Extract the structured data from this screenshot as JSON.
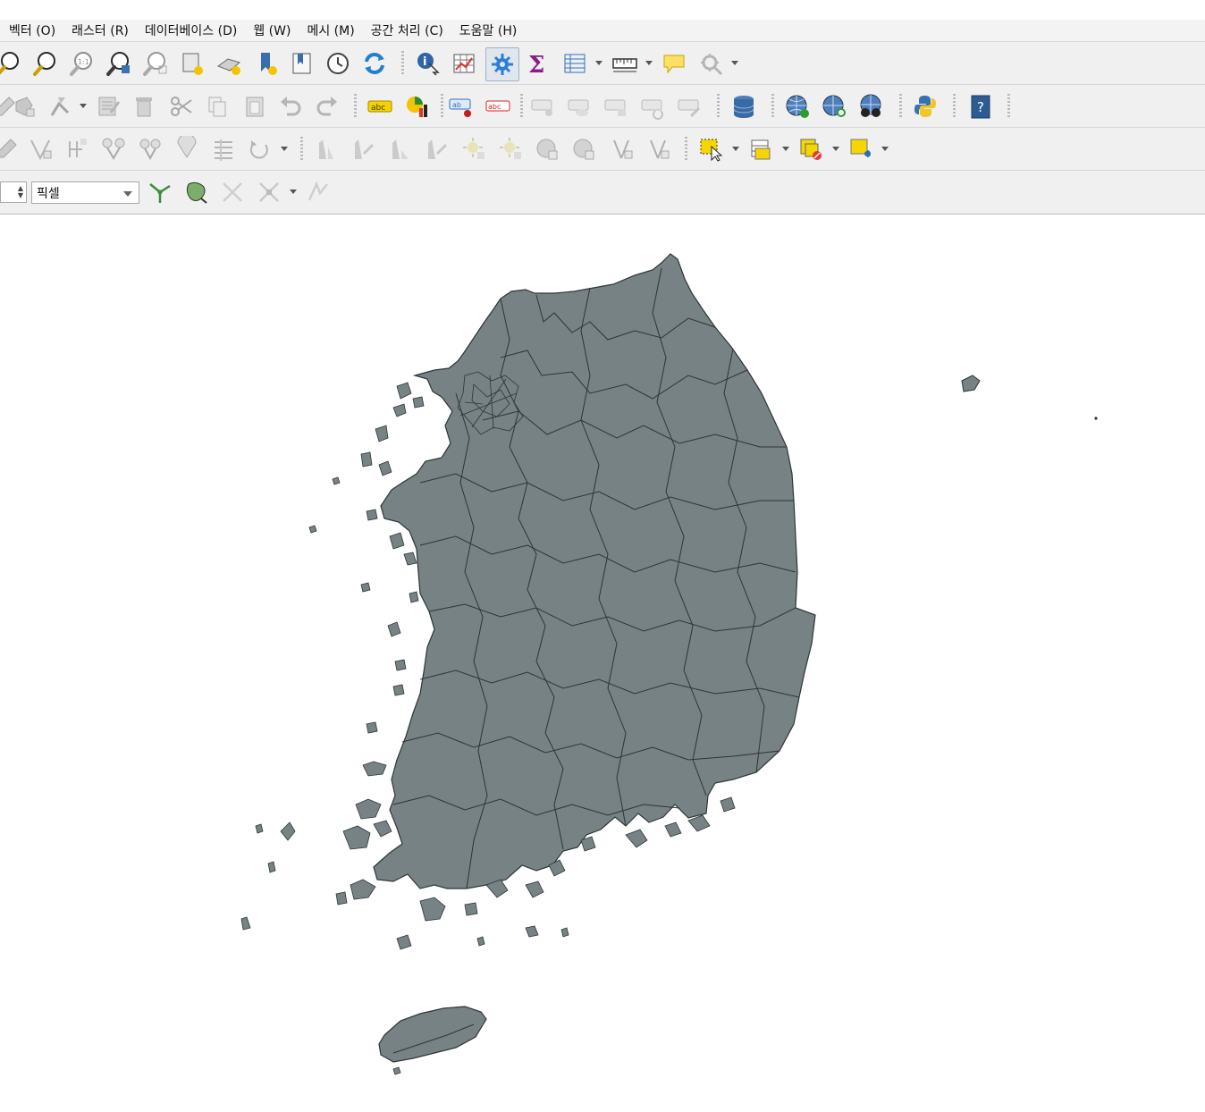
{
  "menu": {
    "items": [
      {
        "label": "벡터 (O)"
      },
      {
        "label": "래스터 (R)"
      },
      {
        "label": "데이터베이스 (D)"
      },
      {
        "label": "웹 (W)"
      },
      {
        "label": "메시 (M)"
      },
      {
        "label": "공간 처리 (C)"
      },
      {
        "label": "도움말 (H)"
      }
    ]
  },
  "snapping": {
    "unit_value": "픽셀"
  },
  "icons": {
    "toolbar1": [
      "zoom-in-icon",
      "zoom-out-icon",
      "zoom-native-icon",
      "zoom-to-selection-icon",
      "zoom-to-layer-icon",
      "new-map-view-icon",
      "new-3d-view-icon",
      "bookmark-new-icon",
      "bookmarks-icon",
      "temporal-clock-icon",
      "refresh-icon",
      "identify-icon",
      "attribute-table-icon",
      "processing-toolbox-icon",
      "statistics-sigma-icon",
      "open-table-icon",
      "measure-icon",
      "map-tips-icon",
      "select-zoom-icon"
    ],
    "toolbar2": [
      "digitize-icon",
      "vertex-tool-icon",
      "merge-icon",
      "edit-form-icon",
      "delete-icon",
      "cut-icon",
      "copy-icon",
      "paste-icon",
      "undo-icon",
      "redo-icon",
      "label-tool-icon",
      "diagram-icon",
      "pin-label-icon",
      "show-label-icon",
      "rotate-label-icon",
      "database-icon",
      "wms-icon",
      "wms-search-icon",
      "metasearch-icon",
      "python-icon",
      "help-icon"
    ],
    "toolbar3": [
      "select-by-area-icon",
      "attribute-select-icon",
      "deselect-icon",
      "select-location-icon"
    ]
  }
}
